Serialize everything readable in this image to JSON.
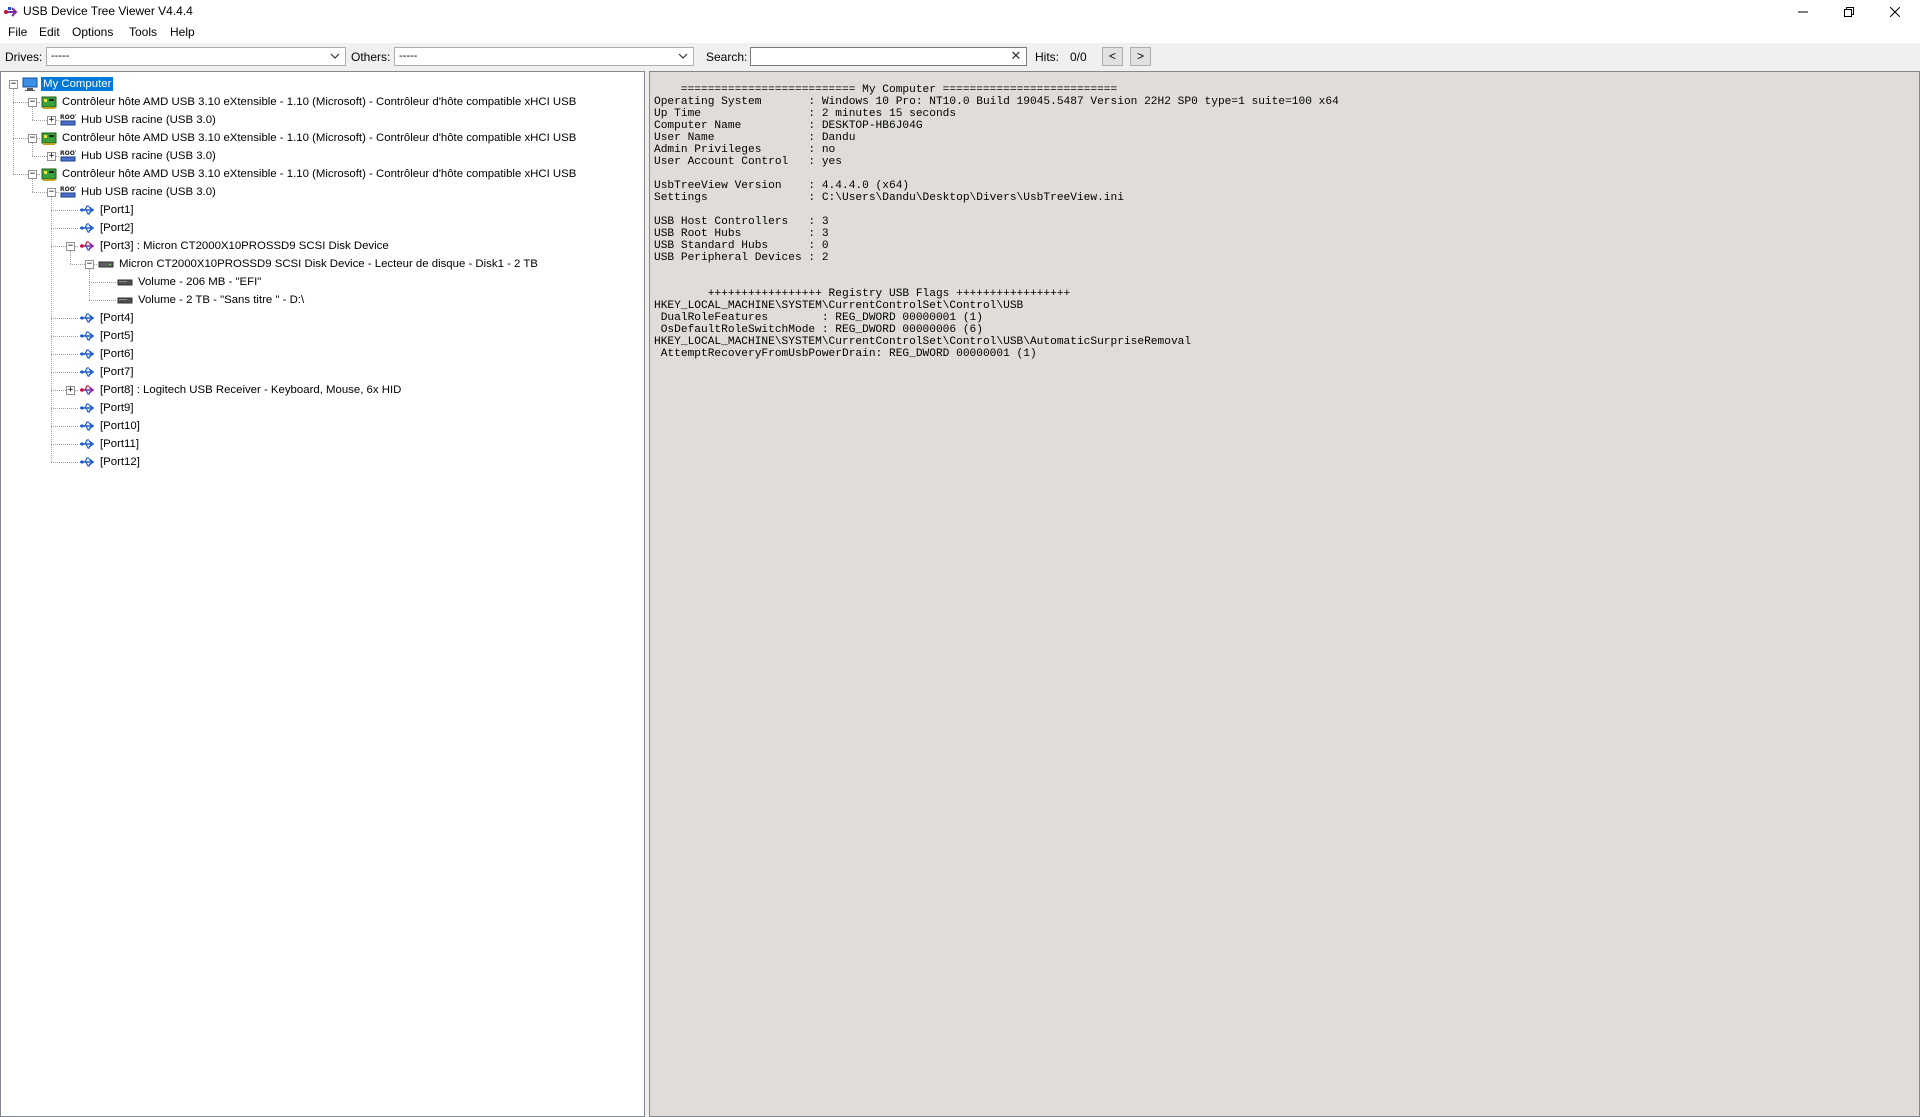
{
  "window": {
    "title": "USB Device Tree Viewer V4.4.4"
  },
  "menu": [
    "File",
    "Edit",
    "Options",
    "Tools",
    "Help"
  ],
  "toolbar": {
    "drives_label": "Drives:",
    "drives_value": "-----",
    "others_label": "Others:",
    "others_value": "-----",
    "search_label": "Search:",
    "search_value": "",
    "hits_label": "Hits:",
    "hits_value": "0/0",
    "prev": "<",
    "next": ">"
  },
  "tree": [
    {
      "label": "My Computer",
      "icon": "computer-icon",
      "level": 0,
      "expander": "minus",
      "selected": true
    },
    {
      "label": "Contrôleur hôte AMD USB 3.10 eXtensible - 1.10 (Microsoft) - Contrôleur d'hôte compatible xHCI USB",
      "icon": "host-controller-icon",
      "level": 1,
      "expander": "minus"
    },
    {
      "label": "Hub USB racine (USB 3.0)",
      "icon": "root-hub-icon",
      "level": 2,
      "expander": "plus"
    },
    {
      "label": "Contrôleur hôte AMD USB 3.10 eXtensible - 1.10 (Microsoft) - Contrôleur d'hôte compatible xHCI USB",
      "icon": "host-controller-icon",
      "level": 1,
      "expander": "minus"
    },
    {
      "label": "Hub USB racine (USB 3.0)",
      "icon": "root-hub-icon",
      "level": 2,
      "expander": "plus"
    },
    {
      "label": "Contrôleur hôte AMD USB 3.10 eXtensible - 1.10 (Microsoft) - Contrôleur d'hôte compatible xHCI USB",
      "icon": "host-controller-icon",
      "level": 1,
      "expander": "minus"
    },
    {
      "label": "Hub USB racine (USB 3.0)",
      "icon": "root-hub-icon",
      "level": 2,
      "expander": "minus"
    },
    {
      "label": "[Port1]",
      "icon": "usb-port-icon",
      "level": 3,
      "expander": "none"
    },
    {
      "label": "[Port2]",
      "icon": "usb-port-icon",
      "level": 3,
      "expander": "none"
    },
    {
      "label": "[Port3] : Micron CT2000X10PROSSD9 SCSI Disk Device",
      "icon": "usb-device-icon",
      "level": 3,
      "expander": "minus"
    },
    {
      "label": "Micron CT2000X10PROSSD9 SCSI Disk Device - Lecteur de disque - Disk1 - 2 TB",
      "icon": "disk-icon",
      "level": 4,
      "expander": "minus"
    },
    {
      "label": "Volume - 206 MB - \"EFI\"",
      "icon": "volume-icon",
      "level": 5,
      "expander": "none"
    },
    {
      "label": "Volume - 2 TB - \"Sans titre \" - D:\\",
      "icon": "volume-icon",
      "level": 5,
      "expander": "none"
    },
    {
      "label": "[Port4]",
      "icon": "usb-port-icon",
      "level": 3,
      "expander": "none"
    },
    {
      "label": "[Port5]",
      "icon": "usb-port-icon",
      "level": 3,
      "expander": "none"
    },
    {
      "label": "[Port6]",
      "icon": "usb-port-icon",
      "level": 3,
      "expander": "none"
    },
    {
      "label": "[Port7]",
      "icon": "usb-port-icon",
      "level": 3,
      "expander": "none"
    },
    {
      "label": "[Port8] : Logitech USB Receiver - Keyboard, Mouse, 6x HID",
      "icon": "usb-device-icon",
      "level": 3,
      "expander": "plus"
    },
    {
      "label": "[Port9]",
      "icon": "usb-port-icon",
      "level": 3,
      "expander": "none"
    },
    {
      "label": "[Port10]",
      "icon": "usb-port-icon",
      "level": 3,
      "expander": "none"
    },
    {
      "label": "[Port11]",
      "icon": "usb-port-icon",
      "level": 3,
      "expander": "none"
    },
    {
      "label": "[Port12]",
      "icon": "usb-port-icon",
      "level": 3,
      "expander": "none"
    }
  ],
  "info": {
    "lines": [
      "    ========================== My Computer ==========================",
      "Operating System       : Windows 10 Pro: NT10.0 Build 19045.5487 Version 22H2 SP0 type=1 suite=100 x64",
      "Up Time                : 2 minutes 15 seconds",
      "Computer Name          : DESKTOP-HB6J04G",
      "User Name              : Dandu",
      "Admin Privileges       : no",
      "User Account Control   : yes",
      "",
      "UsbTreeView Version    : 4.4.4.0 (x64)",
      "Settings               : C:\\Users\\Dandu\\Desktop\\Divers\\UsbTreeView.ini",
      "",
      "USB Host Controllers   : 3",
      "USB Root Hubs          : 3",
      "USB Standard Hubs      : 0",
      "USB Peripheral Devices : 2",
      "",
      "",
      "        +++++++++++++++++ Registry USB Flags +++++++++++++++++",
      "HKEY_LOCAL_MACHINE\\SYSTEM\\CurrentControlSet\\Control\\USB",
      " DualRoleFeatures        : REG_DWORD 00000001 (1)",
      " OsDefaultRoleSwitchMode : REG_DWORD 00000006 (6)",
      "HKEY_LOCAL_MACHINE\\SYSTEM\\CurrentControlSet\\Control\\USB\\AutomaticSurpriseRemoval",
      " AttemptRecoveryFromUsbPowerDrain: REG_DWORD 00000001 (1)"
    ]
  },
  "colors": {
    "selection": "#0078d7",
    "info_background": "#e0ddd9",
    "toolbar_background": "#f0f0f0"
  }
}
